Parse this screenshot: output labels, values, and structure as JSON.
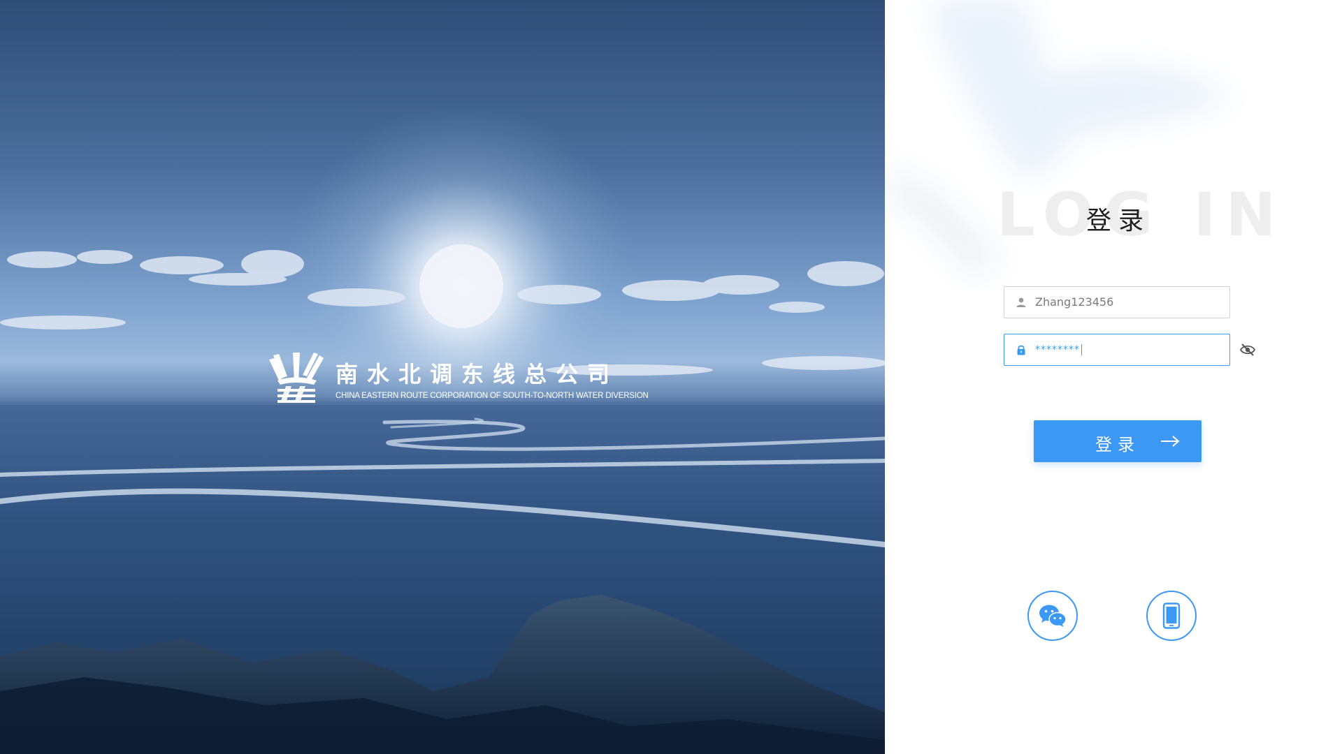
{
  "brand": {
    "name_cn": "南水北调东线总公司",
    "name_en": "CHINA EASTERN ROUTE CORPORATION OF SOUTH-TO-NORTH WATER DIVERSION"
  },
  "login": {
    "watermark": "LOG IN",
    "title": "登录",
    "username_value": "Zhang123456",
    "password_masked": "********",
    "submit_label": "登录"
  },
  "icons": {
    "username": "user-icon",
    "password": "lock-icon",
    "toggle_password": "eye-off-icon",
    "submit_arrow": "arrow-right-icon",
    "wechat": "wechat-icon",
    "phone": "mobile-phone-icon"
  },
  "colors": {
    "accent": "#3b99f5",
    "hero_tint": "#2e4d77"
  }
}
